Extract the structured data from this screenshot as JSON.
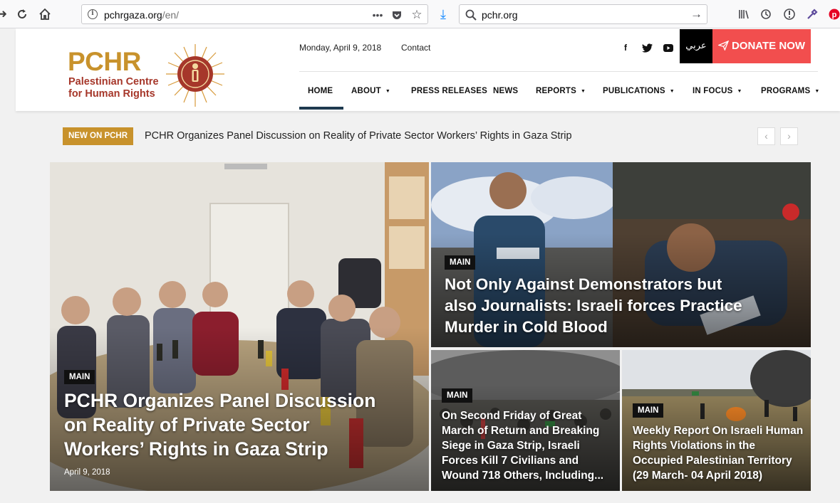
{
  "browser": {
    "url_host": "pchrgaza.org",
    "url_path": "/en/",
    "search_text": "pchr.org",
    "icons": [
      "back-icon",
      "reload-icon",
      "home-icon",
      "info-icon",
      "more-icon",
      "pocket-icon",
      "bookmark-star-icon",
      "download-icon",
      "search-icon",
      "go-arrow-icon",
      "library-icon",
      "history-icon",
      "reader-icon",
      "eyedropper-icon",
      "pinterest-icon"
    ]
  },
  "header": {
    "logo": {
      "big": "PCHR",
      "line1": "Palestinian Centre",
      "line2": "for Human Rights"
    },
    "date": "Monday, April 9, 2018",
    "contact": "Contact",
    "social": [
      "f",
      "t",
      "yt"
    ],
    "arabic": "عربي",
    "donate": "DONATE NOW",
    "menu": [
      {
        "label": "HOME",
        "dropdown": false
      },
      {
        "label": "ABOUT",
        "dropdown": true
      },
      {
        "label": "PRESS RELEASES",
        "dropdown": false
      },
      {
        "label": "NEWS",
        "dropdown": false
      },
      {
        "label": "REPORTS",
        "dropdown": true
      },
      {
        "label": "PUBLICATIONS",
        "dropdown": true
      },
      {
        "label": "IN FOCUS",
        "dropdown": true
      },
      {
        "label": "PROGRAMS",
        "dropdown": true
      }
    ]
  },
  "ticker": {
    "badge": "NEW ON PCHR",
    "text": "PCHR Organizes Panel Discussion on Reality of Private Sector Workers’ Rights in Gaza Strip",
    "prev": "‹",
    "next": "›"
  },
  "featured": [
    {
      "tag": "MAIN",
      "lines": [
        "PCHR Organizes Panel Discussion",
        "on Reality of Private Sector",
        "Workers’ Rights in Gaza Strip"
      ],
      "date": "April 9, 2018"
    },
    {
      "tag": "MAIN",
      "lines": [
        "Not Only Against Demonstrators but",
        "also Journalists: Israeli forces Practice",
        "Murder in Cold Blood"
      ]
    },
    {
      "tag": "MAIN",
      "lines": [
        "On Second Friday of Great",
        "March of Return and Breaking",
        "Siege in Gaza Strip, Israeli",
        "Forces Kill 7 Civilians and",
        "Wound 718 Others, Including..."
      ]
    },
    {
      "tag": "MAIN",
      "lines": [
        "Weekly Report On Israeli Human",
        "Rights Violations in the",
        "Occupied Palestinian Territory",
        "(29 March- 04 April 2018)"
      ]
    }
  ],
  "colors": {
    "gold": "#c8922c",
    "red": "#a6372a",
    "donate": "#f24e4e",
    "nav_active": "#1e3a4f"
  }
}
